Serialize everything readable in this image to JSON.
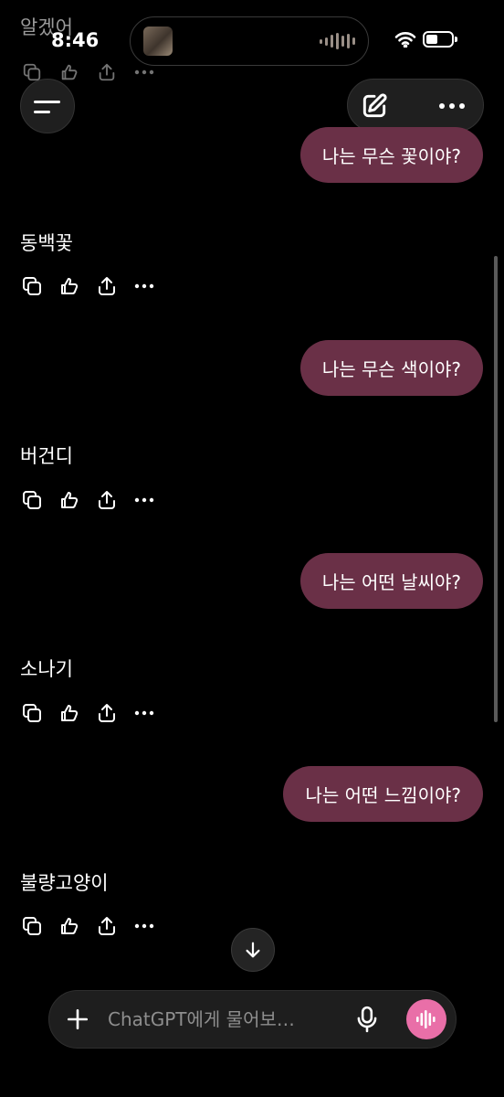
{
  "status_bar": {
    "time": "8:46"
  },
  "previous_message": {
    "text": "알겠어"
  },
  "conversation": [
    {
      "user": "나는 무슨 꽃이야?",
      "assistant": "동백꽃"
    },
    {
      "user": "나는 무슨 색이야?",
      "assistant": "버건디"
    },
    {
      "user": "나는 어떤 날씨야?",
      "assistant": "소나기"
    },
    {
      "user": "나는 어떤 느낌이야?",
      "assistant": "불량고양이"
    }
  ],
  "composer": {
    "placeholder": "ChatGPT에게 물어보…"
  },
  "icons": {
    "menu": "menu-icon",
    "edit": "new-chat-edit-icon",
    "more": "more-dots-icon",
    "copy": "copy-icon",
    "feedback": "thumbs-feedback-icon",
    "share": "share-icon",
    "scroll_down": "arrow-down-icon",
    "plus": "plus-icon",
    "mic": "mic-icon",
    "voice": "voice-wave-icon"
  },
  "colors": {
    "user_bubble": "#6a3047",
    "voice_button": "#e96fa8",
    "background": "#000000"
  }
}
